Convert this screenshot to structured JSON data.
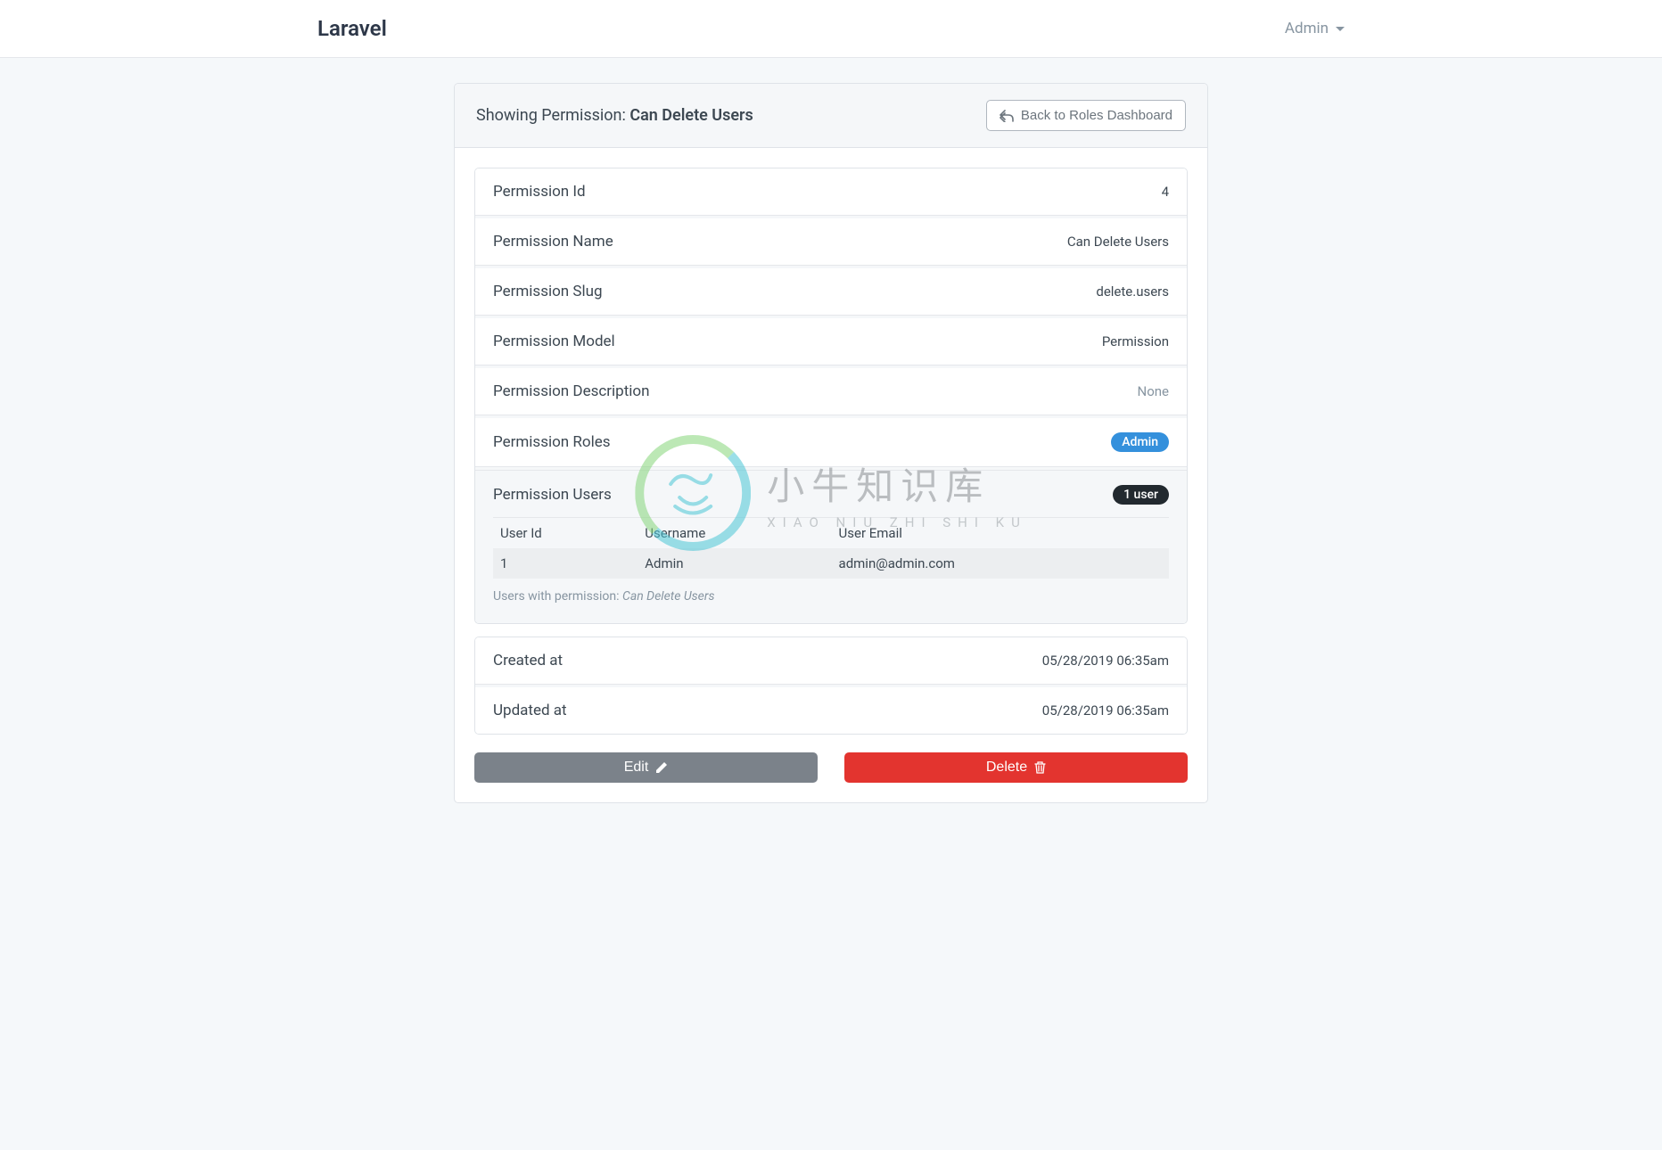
{
  "navbar": {
    "brand": "Laravel",
    "user_label": "Admin"
  },
  "header": {
    "title_prefix": "Showing Permission: ",
    "title_name": "Can Delete Users",
    "back_button": "Back to Roles Dashboard"
  },
  "details": {
    "id_label": "Permission Id",
    "id_value": "4",
    "name_label": "Permission Name",
    "name_value": "Can Delete Users",
    "slug_label": "Permission Slug",
    "slug_value": "delete.users",
    "model_label": "Permission Model",
    "model_value": "Permission",
    "desc_label": "Permission Description",
    "desc_value": "None",
    "roles_label": "Permission Roles",
    "roles_badge": "Admin",
    "users_label": "Permission Users",
    "users_count_badge": "1 user"
  },
  "users_table": {
    "headers": {
      "id": "User Id",
      "username": "Username",
      "email": "User Email"
    },
    "rows": [
      {
        "id": "1",
        "username": "Admin",
        "email": "admin@admin.com"
      }
    ],
    "caption_prefix": "Users with permission: ",
    "caption_name": "Can Delete Users"
  },
  "meta": {
    "created_label": "Created at",
    "created_value": "05/28/2019 06:35am",
    "updated_label": "Updated at",
    "updated_value": "05/28/2019 06:35am"
  },
  "actions": {
    "edit": "Edit",
    "delete": "Delete"
  },
  "watermark": {
    "main": "小牛知识库",
    "sub": "XIAO NIU ZHI SHI KU"
  }
}
